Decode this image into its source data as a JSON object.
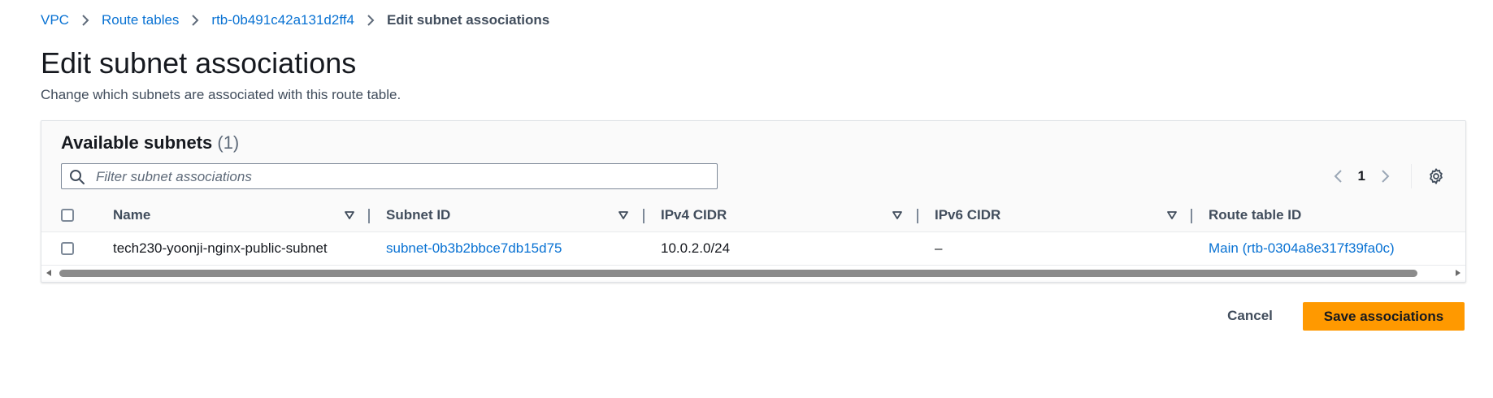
{
  "breadcrumb": {
    "items": [
      {
        "label": "VPC"
      },
      {
        "label": "Route tables"
      },
      {
        "label": "rtb-0b491c42a131d2ff4"
      },
      {
        "label": "Edit subnet associations"
      }
    ]
  },
  "header": {
    "title": "Edit subnet associations",
    "description": "Change which subnets are associated with this route table."
  },
  "subnets_panel": {
    "title": "Available subnets",
    "count": "(1)",
    "filter_placeholder": "Filter subnet associations",
    "filter_value": "",
    "page": "1"
  },
  "table": {
    "columns": [
      {
        "label": "Name"
      },
      {
        "label": "Subnet ID"
      },
      {
        "label": "IPv4 CIDR"
      },
      {
        "label": "IPv6 CIDR"
      },
      {
        "label": "Route table ID"
      }
    ],
    "rows": [
      {
        "name": "tech230-yoonji-nginx-public-subnet",
        "subnet_id": "subnet-0b3b2bbce7db15d75",
        "ipv4_cidr": "10.0.2.0/24",
        "ipv6_cidr": "–",
        "route_table_id": "Main (rtb-0304a8e317f39fa0c)",
        "selected": false
      }
    ]
  },
  "actions": {
    "cancel_label": "Cancel",
    "save_label": "Save associations"
  },
  "colors": {
    "link": "#0972d3",
    "primary_button": "#ff9900",
    "text": "#16191f",
    "secondary_text": "#414d5c"
  },
  "icons": {
    "breadcrumb_separator": "chevron-right-icon",
    "filter": "search-icon",
    "pager_prev": "chevron-left-icon",
    "pager_next": "chevron-right-icon",
    "settings": "gear-icon",
    "sort": "caret-down-icon"
  }
}
